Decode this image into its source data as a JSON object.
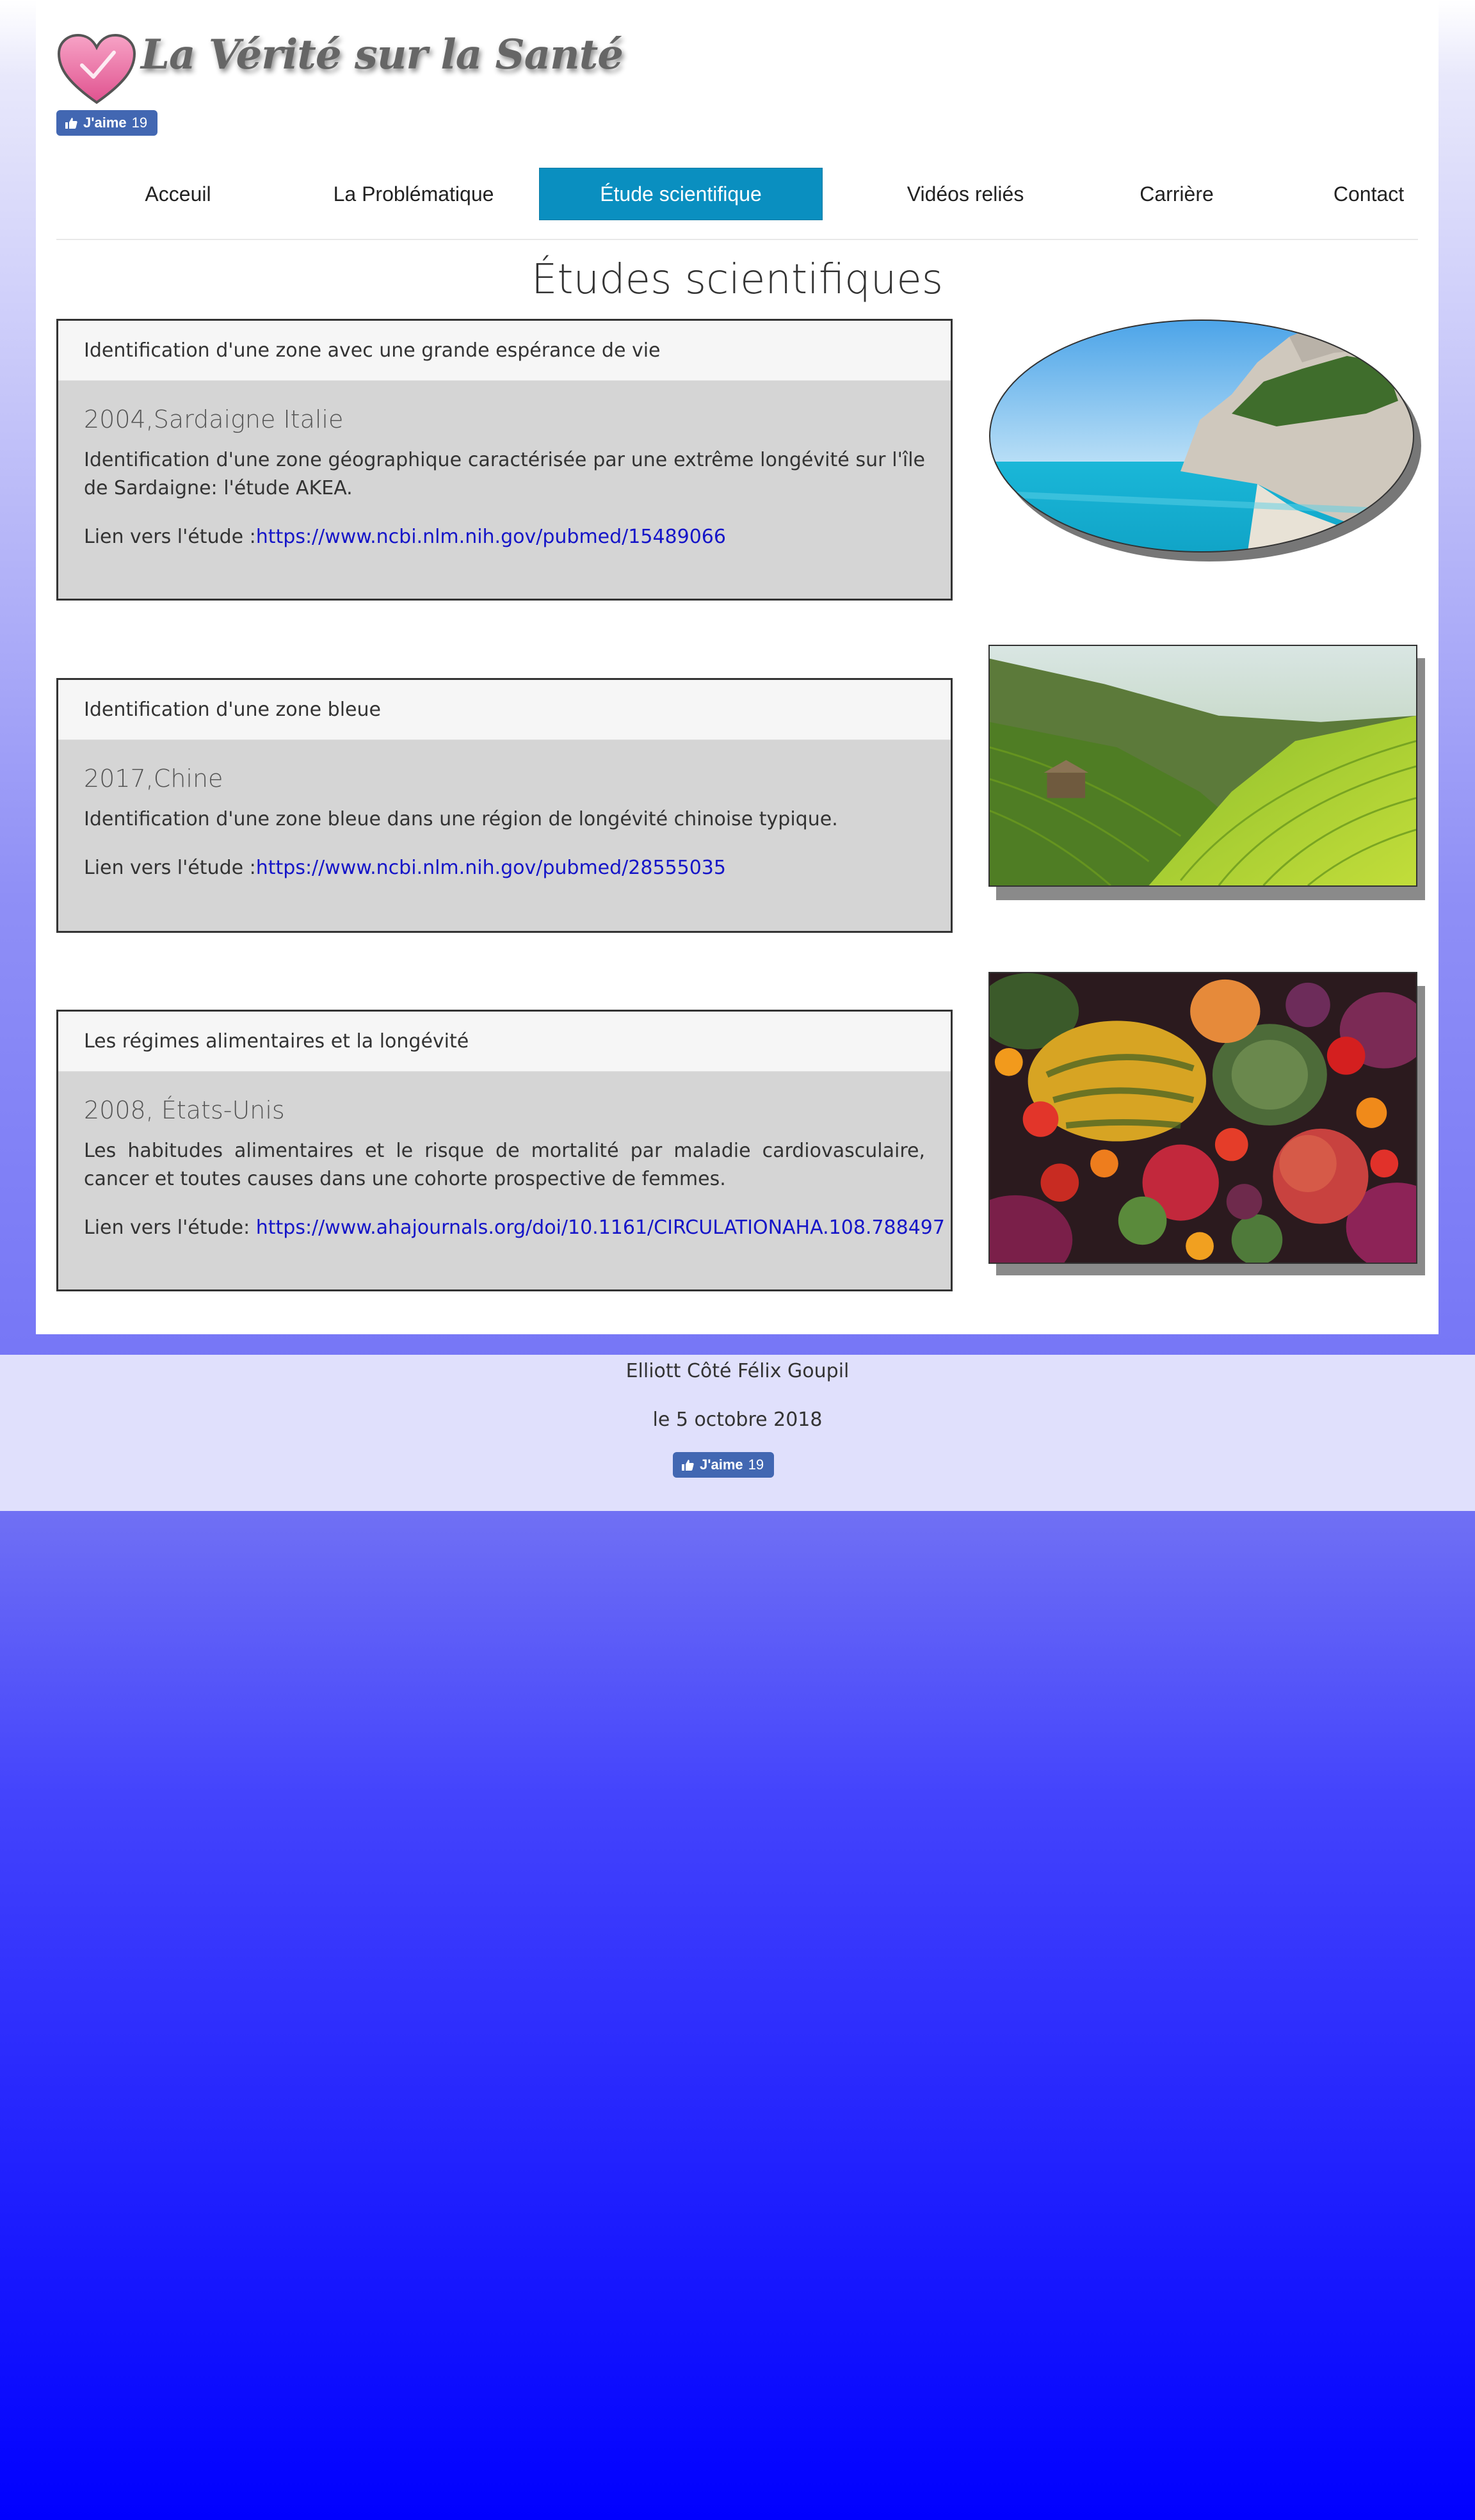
{
  "header": {
    "site_title": "La Vérité sur la Santé",
    "like_label": "J'aime",
    "like_count": "19",
    "logo_color": "#e96aa0"
  },
  "nav": {
    "items": [
      {
        "label": "Acceuil"
      },
      {
        "label": "La Problématique"
      },
      {
        "label": "Étude scientifique",
        "active": true
      },
      {
        "label": "Vidéos reliés"
      },
      {
        "label": "Carrière"
      },
      {
        "label": "Contact"
      }
    ],
    "active_color": "#0a8fc0"
  },
  "main": {
    "heading": "Études scientifiques",
    "studies": [
      {
        "title": "Identification d'une zone avec une grande espérance de vie",
        "subtitle": "2004,Sardaigne Italie",
        "text": "Identification d'une zone géographique caractérisée par une extrême longévité sur l'île de Sardaigne: l'étude AKEA.",
        "link_prefix": "Lien vers l'étude :",
        "link_url": "https://www.ncbi.nlm.nih.gov/pubmed/15489066",
        "image": "sardinia-coast-photo"
      },
      {
        "title": "Identification d'une zone bleue",
        "subtitle": "2017,Chine",
        "text": "Identification d'une zone bleue dans une région de longévité chinoise typique.",
        "link_prefix": "Lien vers l'étude :",
        "link_url": "https://www.ncbi.nlm.nih.gov/pubmed/28555035",
        "image": "rice-terraces-photo"
      },
      {
        "title": "Les régimes alimentaires et la longévité",
        "subtitle": "2008, États-Unis",
        "text": "Les habitudes alimentaires et le risque de mortalité par maladie cardiovasculaire, cancer et toutes causes dans une cohorte prospective de femmes.",
        "link_prefix": "Lien vers l'étude: ",
        "link_url": "https://www.ahajournals.org/doi/10.1161/CIRCULATIONAHA.108.788497",
        "image": "vegetables-photo"
      }
    ]
  },
  "footer": {
    "authors": "Elliott Côté Félix Goupil",
    "date": "le 5 octobre 2018",
    "like_label": "J'aime",
    "like_count": "19"
  },
  "colors": {
    "link": "#1515c8",
    "panel_bg": "#d5d5d5",
    "footer_bg": "#e0e0fc",
    "page_gradient_end": "#0000ff"
  }
}
